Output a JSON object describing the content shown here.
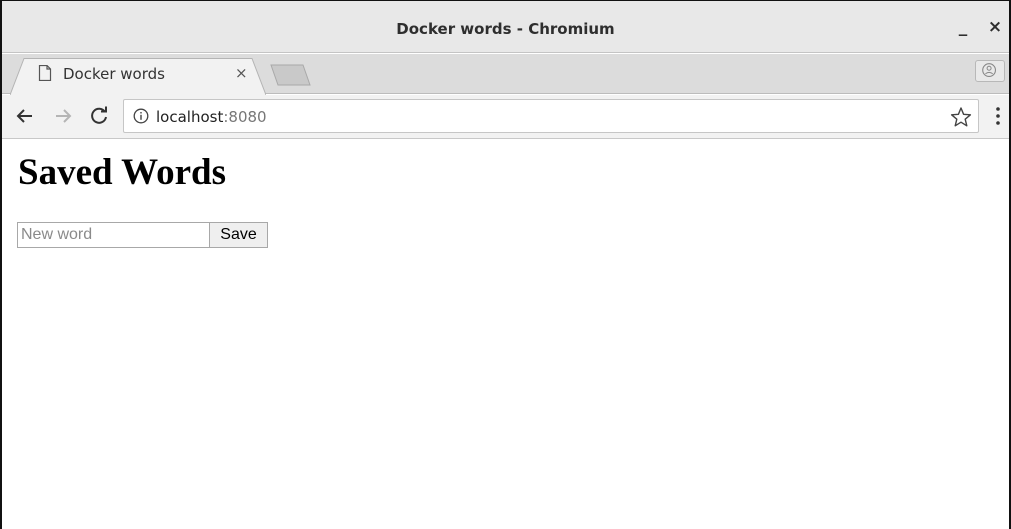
{
  "window": {
    "title": "Docker words - Chromium",
    "minimize_label": "_",
    "close_label": "×"
  },
  "tab": {
    "title": "Docker words",
    "close_label": "×"
  },
  "toolbar": {
    "url_host": "localhost",
    "url_port": ":8080"
  },
  "page": {
    "heading": "Saved Words",
    "input_placeholder": "New word",
    "input_value": "",
    "save_label": "Save",
    "words": []
  },
  "icons": {
    "back": "arrow-left-icon",
    "forward": "arrow-right-icon",
    "reload": "reload-icon",
    "info": "info-icon",
    "bookmark": "star-icon",
    "menu": "kebab-menu-icon",
    "profile": "profile-icon",
    "tab_favicon": "page-icon"
  }
}
